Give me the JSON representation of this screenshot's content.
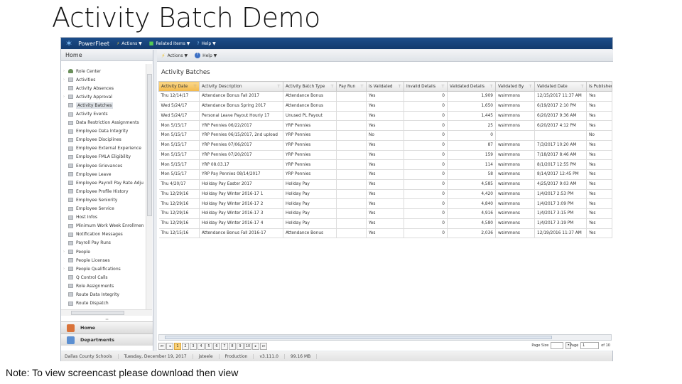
{
  "slide": {
    "title": "Activity Batch Demo",
    "note": "Note: To view screencast please download then view"
  },
  "topnav": {
    "brand": "PowerFleet",
    "actions": "Actions ▼",
    "related": "Related Items ▼",
    "help": "Help ▼"
  },
  "left": {
    "header": "Home",
    "items": [
      {
        "label": "Role Center",
        "exp": true
      },
      {
        "label": "Activities",
        "exp": true
      },
      {
        "label": "Activity Absences"
      },
      {
        "label": "Activity Approval",
        "exp": true
      },
      {
        "label": "Activity Batches",
        "selected": true
      },
      {
        "label": "Activity Events"
      },
      {
        "label": "Data Restriction Assignments"
      },
      {
        "label": "Employee Data Integrity"
      },
      {
        "label": "Employee Disciplines"
      },
      {
        "label": "Employee External Experience"
      },
      {
        "label": "Employee FMLA Eligibility"
      },
      {
        "label": "Employee Grievances"
      },
      {
        "label": "Employee Leave"
      },
      {
        "label": "Employee Payroll Pay Rate Adju"
      },
      {
        "label": "Employee Profile History"
      },
      {
        "label": "Employee Seniority"
      },
      {
        "label": "Employee Service"
      },
      {
        "label": "Host Infos"
      },
      {
        "label": "Minimum Work Week Enrollmen"
      },
      {
        "label": "Notification Messages"
      },
      {
        "label": "Payroll Pay Runs"
      },
      {
        "label": "People",
        "exp": true
      },
      {
        "label": "People Licenses"
      },
      {
        "label": "People Qualifications",
        "exp": true
      },
      {
        "label": "Q Control Calls"
      },
      {
        "label": "Role Assignments"
      },
      {
        "label": "Route Data Integrity"
      },
      {
        "label": "Route Dispatch"
      }
    ],
    "nav_home": "Home",
    "nav_departments": "Departments"
  },
  "toolbar": {
    "actions": "Actions ▼",
    "help": "Help ▼"
  },
  "main": {
    "heading": "Activity Batches",
    "columns": [
      "Activity Date",
      "Activity Description",
      "Activity Batch Type",
      "Pay Run",
      "Is Validated",
      "Invalid Details",
      "Validated Details",
      "Validated By",
      "Validated Date",
      "Is Published"
    ],
    "rows": [
      [
        "Thu 12/14/17",
        "Attendance Bonus Fall 2017",
        "Attendance Bonus",
        "",
        "Yes",
        "0",
        "1,909",
        "wsimmons",
        "12/15/2017 11:37 AM",
        "Yes"
      ],
      [
        "Wed 5/24/17",
        "Attendance Bonus Spring 2017",
        "Attendance Bonus",
        "",
        "Yes",
        "0",
        "1,650",
        "wsimmons",
        "6/19/2017 2:10 PM",
        "Yes"
      ],
      [
        "Wed 5/24/17",
        "Personal Leave Payout Hourly 17",
        "Unused PL Payout",
        "",
        "Yes",
        "0",
        "1,445",
        "wsimmons",
        "6/20/2017 9:36 AM",
        "Yes"
      ],
      [
        "Mon 5/15/17",
        "YRP Pennies 06/22/2017",
        "YRP Pennies",
        "",
        "Yes",
        "0",
        "25",
        "wsimmons",
        "6/20/2017 4:12 PM",
        "Yes"
      ],
      [
        "Mon 5/15/17",
        "YRP Pennies 06/15/2017, 2nd upload",
        "YRP Pennies",
        "",
        "No",
        "0",
        "0",
        "",
        "",
        "No"
      ],
      [
        "Mon 5/15/17",
        "YRP Pennies 07/06/2017",
        "YRP Pennies",
        "",
        "Yes",
        "0",
        "87",
        "wsimmons",
        "7/3/2017 10:20 AM",
        "Yes"
      ],
      [
        "Mon 5/15/17",
        "YRP Pennies 07/20/2017",
        "YRP Pennies",
        "",
        "Yes",
        "0",
        "159",
        "wsimmons",
        "7/18/2017 8:46 AM",
        "Yes"
      ],
      [
        "Mon 5/15/17",
        "YRP 08.03.17",
        "YRP Pennies",
        "",
        "Yes",
        "0",
        "114",
        "wsimmons",
        "8/1/2017 12:55 PM",
        "Yes"
      ],
      [
        "Mon 5/15/17",
        "YRP Pay Pennies 08/14/2017",
        "YRP Pennies",
        "",
        "Yes",
        "0",
        "58",
        "wsimmons",
        "8/14/2017 12:45 PM",
        "Yes"
      ],
      [
        "Thu 4/20/17",
        "Holiday Pay Easter 2017",
        "Holiday Pay",
        "",
        "Yes",
        "0",
        "4,585",
        "wsimmons",
        "4/25/2017 9:03 AM",
        "Yes"
      ],
      [
        "Thu 12/29/16",
        "Holiday Pay Winter 2016-17 1",
        "Holiday Pay",
        "",
        "Yes",
        "0",
        "4,420",
        "wsimmons",
        "1/4/2017 2:53 PM",
        "Yes"
      ],
      [
        "Thu 12/29/16",
        "Holiday Pay Winter 2016-17 2",
        "Holiday Pay",
        "",
        "Yes",
        "0",
        "4,840",
        "wsimmons",
        "1/4/2017 3:09 PM",
        "Yes"
      ],
      [
        "Thu 12/29/16",
        "Holiday Pay Winter 2016-17 3",
        "Holiday Pay",
        "",
        "Yes",
        "0",
        "4,916",
        "wsimmons",
        "1/4/2017 3:15 PM",
        "Yes"
      ],
      [
        "Thu 12/29/16",
        "Holiday Pay Winter 2016-17 4",
        "Holiday Pay",
        "",
        "Yes",
        "0",
        "4,580",
        "wsimmons",
        "1/4/2017 3:19 PM",
        "Yes"
      ],
      [
        "Thu 12/15/16",
        "Attendance Bonus Fall 2016-17",
        "Attendance Bonus",
        "",
        "Yes",
        "0",
        "2,036",
        "wsimmons",
        "12/19/2016 11:37 AM",
        "Yes"
      ]
    ]
  },
  "pager": {
    "pages": [
      "1",
      "2",
      "3",
      "4",
      "5",
      "6",
      "7",
      "8",
      "9",
      "10"
    ],
    "current": "1",
    "page_size_label": "Page Size",
    "page_size_value": "",
    "page_label": "Page",
    "page_value": "1",
    "of_label": "of 10"
  },
  "status": [
    "Dallas County Schools",
    "Tuesday, December 19, 2017",
    "jsteele",
    "Production",
    "v3.111.0",
    "99.16 MB"
  ]
}
